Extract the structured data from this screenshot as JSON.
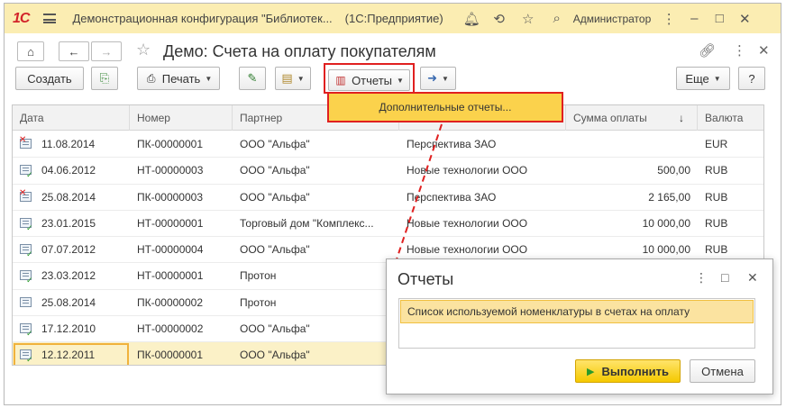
{
  "titlebar": {
    "logo": "1С",
    "title": "Демонстрационная конфигурация \"Библиотек...",
    "app": "(1С:Предприятие)",
    "user": "Администратор"
  },
  "form": {
    "title": "Демо: Счета на оплату покупателям"
  },
  "toolbar": {
    "create": "Создать",
    "print": "Печать",
    "reports": "Отчеты",
    "more": "Еще",
    "help": "?"
  },
  "dropdown": {
    "item": "Дополнительные отчеты..."
  },
  "table": {
    "columns": [
      "Дата",
      "Номер",
      "Партнер",
      "",
      "Сумма оплаты",
      "Валюта"
    ],
    "sort_indicator": "↓",
    "rows": [
      {
        "date": "11.08.2014",
        "number": "ПК-00000001",
        "partner": "ООО \"Альфа\"",
        "org": "Перспектива ЗАО",
        "sum": "",
        "currency": "EUR",
        "mark": "red"
      },
      {
        "date": "04.06.2012",
        "number": "НТ-00000003",
        "partner": "ООО \"Альфа\"",
        "org": "Новые технологии ООО",
        "sum": "500,00",
        "currency": "RUB",
        "mark": "green"
      },
      {
        "date": "25.08.2014",
        "number": "ПК-00000003",
        "partner": "ООО \"Альфа\"",
        "org": "Перспектива ЗАО",
        "sum": "2 165,00",
        "currency": "RUB",
        "mark": "red"
      },
      {
        "date": "23.01.2015",
        "number": "НТ-00000001",
        "partner": "Торговый дом \"Комплекс...",
        "org": "Новые технологии ООО",
        "sum": "10 000,00",
        "currency": "RUB",
        "mark": "green"
      },
      {
        "date": "07.07.2012",
        "number": "НТ-00000004",
        "partner": "ООО \"Альфа\"",
        "org": "Новые технологии ООО",
        "sum": "10 000,00",
        "currency": "RUB",
        "mark": "green"
      },
      {
        "date": "23.03.2012",
        "number": "НТ-00000001",
        "partner": "Протон",
        "org": "",
        "sum": "",
        "currency": "",
        "mark": "green"
      },
      {
        "date": "25.08.2014",
        "number": "ПК-00000002",
        "partner": "Протон",
        "org": "",
        "sum": "",
        "currency": "",
        "mark": "none"
      },
      {
        "date": "17.12.2010",
        "number": "НТ-00000002",
        "partner": "ООО \"Альфа\"",
        "org": "",
        "sum": "",
        "currency": "",
        "mark": "green"
      },
      {
        "date": "12.12.2011",
        "number": "ПК-00000001",
        "partner": "ООО \"Альфа\"",
        "org": "",
        "sum": "",
        "currency": "",
        "mark": "green"
      }
    ]
  },
  "dialog": {
    "title": "Отчеты",
    "item": "Список используемой номенклатуры в счетах на оплату",
    "run": "Выполнить",
    "cancel": "Отмена"
  },
  "colors": {
    "titlebar": "#fbedb2",
    "accent_red": "#e02020",
    "highlight": "#fbd24c"
  }
}
